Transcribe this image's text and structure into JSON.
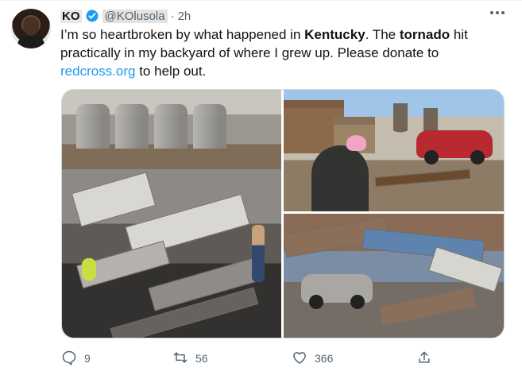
{
  "tweet": {
    "author": {
      "name": "KO",
      "handle": "@KOlusola",
      "time": "2h",
      "verified": true
    },
    "text_runs": [
      {
        "text": "I’m so heartbroken by what happened in ",
        "style": "normal"
      },
      {
        "text": "Kentucky",
        "style": "bold"
      },
      {
        "text": ". The ",
        "style": "normal"
      },
      {
        "text": "tornado",
        "style": "bold"
      },
      {
        "text": " hit practically in my backyard of where I grew up. Please donate to ",
        "style": "normal"
      },
      {
        "text": "redcross.org",
        "style": "link"
      },
      {
        "text": " to help out.",
        "style": "normal"
      }
    ],
    "media_count": 3,
    "metrics": {
      "replies": "9",
      "retweets": "56",
      "likes": "366"
    }
  },
  "ui": {
    "separator": "·",
    "icons": [
      "more-icon",
      "verified-icon",
      "reply-icon",
      "retweet-icon",
      "like-icon",
      "share-icon"
    ],
    "colors": {
      "link": "#1d9bf0",
      "muted": "#536471",
      "verified": "#1d9bf0",
      "border": "#cfd9de"
    }
  }
}
